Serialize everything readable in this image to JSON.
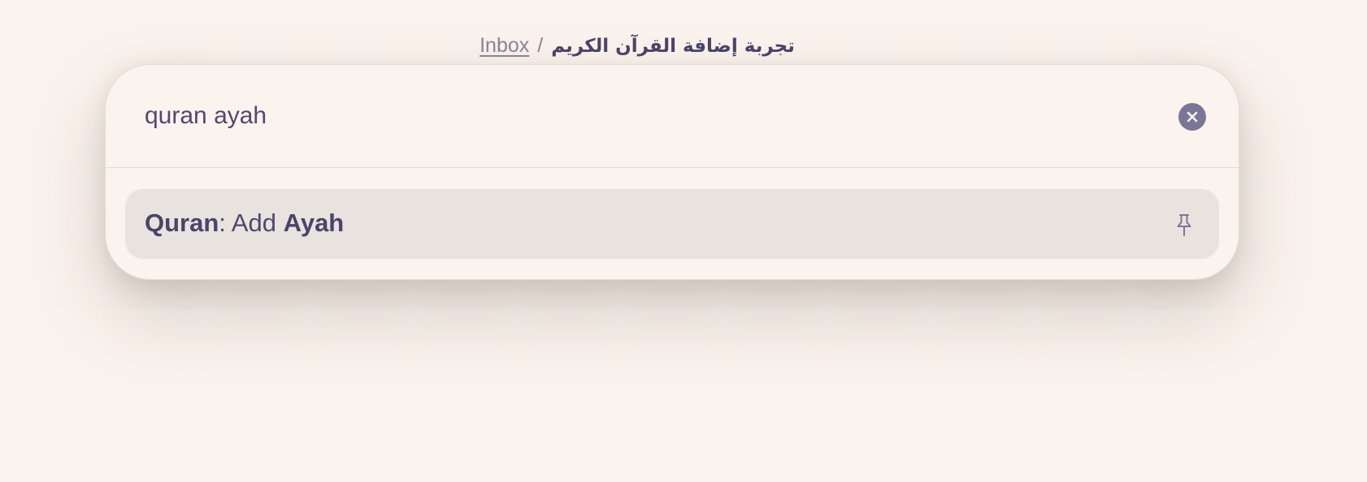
{
  "breadcrumb": {
    "link_label": "Inbox",
    "separator": "/",
    "current_label": "تجربة إضافة القرآن الكريم"
  },
  "palette": {
    "search": {
      "value": "quran ayah",
      "placeholder": ""
    },
    "clear_icon": "close-circle-icon",
    "results": [
      {
        "bold_1": "Quran",
        "middle": ": Add ",
        "bold_2": "Ayah",
        "pin_icon": "pin-icon"
      }
    ]
  },
  "colors": {
    "background": "#fbf3ed",
    "text": "#4f4970",
    "accent_icon": "#7b7697",
    "highlight_row": "#e8e3de"
  }
}
